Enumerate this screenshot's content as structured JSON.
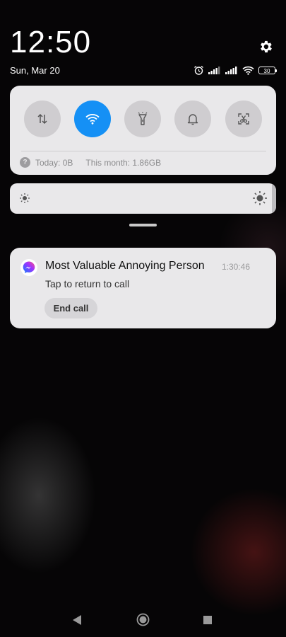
{
  "status": {
    "time": "12:50",
    "date": "Sun, Mar 20",
    "battery": "30"
  },
  "quick_settings": {
    "toggles": [
      {
        "name": "mobile-data",
        "active": false
      },
      {
        "name": "wifi",
        "active": true
      },
      {
        "name": "flashlight",
        "active": false
      },
      {
        "name": "notifications",
        "active": false
      },
      {
        "name": "screenshot",
        "active": false
      }
    ],
    "data_usage": {
      "today": "Today: 0B",
      "month": "This month: 1.86GB"
    }
  },
  "brightness": {
    "level": 0.98
  },
  "notification": {
    "app_icon": "messenger-icon",
    "title": "Most Valuable Annoying Person",
    "time": "1:30:46",
    "body": "Tap to return to call",
    "action": "End call"
  },
  "colors": {
    "accent": "#1590f5",
    "panel": "#e9e8ea",
    "messenger_gradient": [
      "#0a7cff",
      "#a033ff",
      "#ff5280"
    ]
  }
}
